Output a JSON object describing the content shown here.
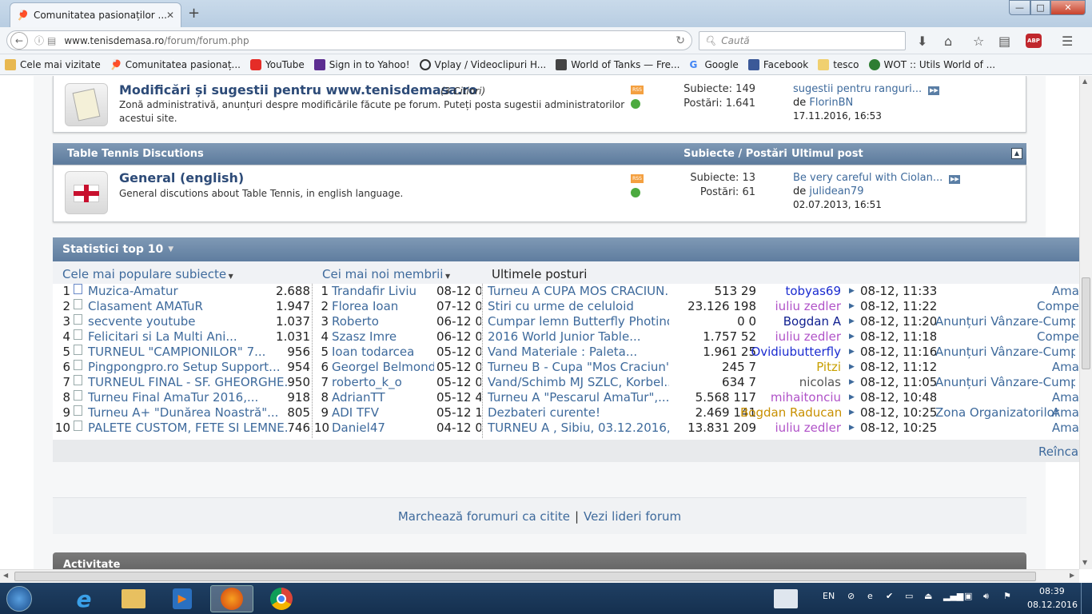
{
  "browser": {
    "tab_title": "Comunitatea pasionaților ...",
    "new_tab": "+",
    "window_buttons": {
      "minimize": "—",
      "maximize": "□",
      "close": "✕"
    },
    "url_domain": "www.tenisdemasa.ro",
    "url_path": "/forum/forum.php",
    "search_placeholder": "Caută",
    "bookmarks": [
      "Cele mai vizitate",
      "Comunitatea pasionaț...",
      "YouTube",
      "Sign in to Yahoo!",
      "Vplay / Videoclipuri H...",
      "World of Tanks — Fre...",
      "Google",
      "Facebook",
      "tesco",
      "WOT :: Utils World of ..."
    ],
    "abp_label": "ABP"
  },
  "forum1": {
    "title": "Modificări și sugestii pentru www.tenisdemasa.ro",
    "readers": "(3 Citiori)",
    "desc1": "Zonă administrativă, anunțuri despre modificările făcute pe forum. Puteți posta sugestii administratorilor",
    "desc2": "acestui site.",
    "subjects": "Subiecte: 149",
    "posts": "Postări: 1.641",
    "last_title": "sugestii pentru ranguri...",
    "last_by": "de",
    "last_user": "FlorinBN",
    "last_date": "17.11.2016, 16:53"
  },
  "category": {
    "name": "Table Tennis Discutions",
    "col_stats": "Subiecte / Postări",
    "col_last": "Ultimul post"
  },
  "forum2": {
    "title": "General (english)",
    "desc": "General discutions about Table Tennis, in english language.",
    "subjects": "Subiecte: 13",
    "posts": "Postări: 61",
    "last_title": "Be very careful with Ciolan...",
    "last_by": "de",
    "last_user": "julidean79",
    "last_date": "02.07.2013, 16:51"
  },
  "stats": {
    "title": "Statistici top 10",
    "col_popular": "Cele mai populare subiecte",
    "col_members": "Cei mai noi membrii",
    "col_posts": "Ultimele posturi",
    "reload": "Reîncar",
    "rows": [
      {
        "n": "1",
        "topic": "Muzica-Amatur",
        "views": "2.688",
        "m": "1",
        "member": "Trandafir Liviu",
        "jd": "08-12 0",
        "post": "Turneu A CUPA MOS CRACIUN...",
        "pv": "513 29",
        "user": "tobyas69",
        "uc": "#1a2bd0",
        "time": "08-12, 11:33",
        "forum": "",
        "cat": "Ama"
      },
      {
        "n": "2",
        "topic": "Clasament AMATuR",
        "views": "1.947",
        "m": "2",
        "member": "Florea Ioan",
        "jd": "07-12 0",
        "post": "Stiri cu urme de celuloid",
        "pv": "23.126 198",
        "user": "iuliu zedler",
        "uc": "#b052c8",
        "time": "08-12, 11:22",
        "forum": "",
        "cat": "Compe"
      },
      {
        "n": "3",
        "topic": "secvente youtube",
        "views": "1.037",
        "m": "3",
        "member": "Roberto",
        "jd": "06-12 0",
        "post": "Cumpar lemn Butterfly Photino...",
        "pv": "0 0",
        "user": "Bogdan A",
        "uc": "#102090",
        "time": "08-12, 11:20",
        "forum": "Anunțuri Vânzare-Cumpăr",
        "cat": ""
      },
      {
        "n": "4",
        "topic": "Felicitari si La Multi Ani...",
        "views": "1.031",
        "m": "4",
        "member": "Szasz Imre",
        "jd": "06-12 0",
        "post": "2016 World Junior Table...",
        "pv": "1.757 52",
        "user": "iuliu zedler",
        "uc": "#b052c8",
        "time": "08-12, 11:18",
        "forum": "",
        "cat": "Compe"
      },
      {
        "n": "5",
        "topic": "TURNEUL \"CAMPIONILOR\" 7...",
        "views": "956",
        "m": "5",
        "member": "Ioan todarcea",
        "jd": "05-12 0",
        "post": "Vand Materiale : Paleta...",
        "pv": "1.961 25",
        "user": "Ovidiubutterfly",
        "uc": "#1a2bd0",
        "time": "08-12, 11:16",
        "forum": "Anunțuri Vânzare-Cumpăr",
        "cat": ""
      },
      {
        "n": "6",
        "topic": "Pingpongpro.ro Setup Support...",
        "views": "954",
        "m": "6",
        "member": "Georgel Belmondo",
        "jd": "05-12 0",
        "post": "Turneu B - Cupa \"Mos Craciun\"...",
        "pv": "245 7",
        "user": "Pitzi",
        "uc": "#c8a000",
        "time": "08-12, 11:12",
        "forum": "",
        "cat": "Ama"
      },
      {
        "n": "7",
        "topic": "TURNEUL FINAL - SF. GHEORGHE...",
        "views": "950",
        "m": "7",
        "member": "roberto_k_o",
        "jd": "05-12 0",
        "post": "Vand/Schimb MJ SZLC, Korbel...",
        "pv": "634 7",
        "user": "nicolas",
        "uc": "#555555",
        "time": "08-12, 11:05",
        "forum": "Anunțuri Vânzare-Cumpăr",
        "cat": ""
      },
      {
        "n": "8",
        "topic": "Turneu Final AmaTur 2016,...",
        "views": "918",
        "m": "8",
        "member": "AdrianTT",
        "jd": "05-12 4",
        "post": "Turneu A \"Pescarul AmaTur\",...",
        "pv": "5.568 117",
        "user": "mihaitonciu",
        "uc": "#b052c8",
        "time": "08-12, 10:48",
        "forum": "",
        "cat": "Ama"
      },
      {
        "n": "9",
        "topic": "Turneu A+ \"Dunărea Noastră\"...",
        "views": "805",
        "m": "9",
        "member": "ADI TFV",
        "jd": "05-12 1",
        "post": "Dezbateri curente!",
        "pv": "2.469 141",
        "user": "Bogdan Raducan",
        "uc": "#c89000",
        "time": "08-12, 10:25",
        "forum": "Zona Organizatorilor",
        "cat": "Ama"
      },
      {
        "n": "10",
        "topic": "PALETE CUSTOM, FETE SI LEMNE...",
        "views": "746",
        "m": "10",
        "member": "Daniel47",
        "jd": "04-12 0",
        "post": "TURNEU A , Sibiu, 03.12.2016,...",
        "pv": "13.831 209",
        "user": "iuliu zedler",
        "uc": "#b052c8",
        "time": "08-12, 10:25",
        "forum": "",
        "cat": "Ama"
      }
    ]
  },
  "footer_links": {
    "mark_read": "Marchează forumuri ca citite",
    "sep": "|",
    "leaders": "Vezi lideri forum"
  },
  "activity": {
    "title": "Activitate"
  },
  "tray": {
    "lang": "EN",
    "time": "08:39",
    "date": "08.12.2016"
  }
}
